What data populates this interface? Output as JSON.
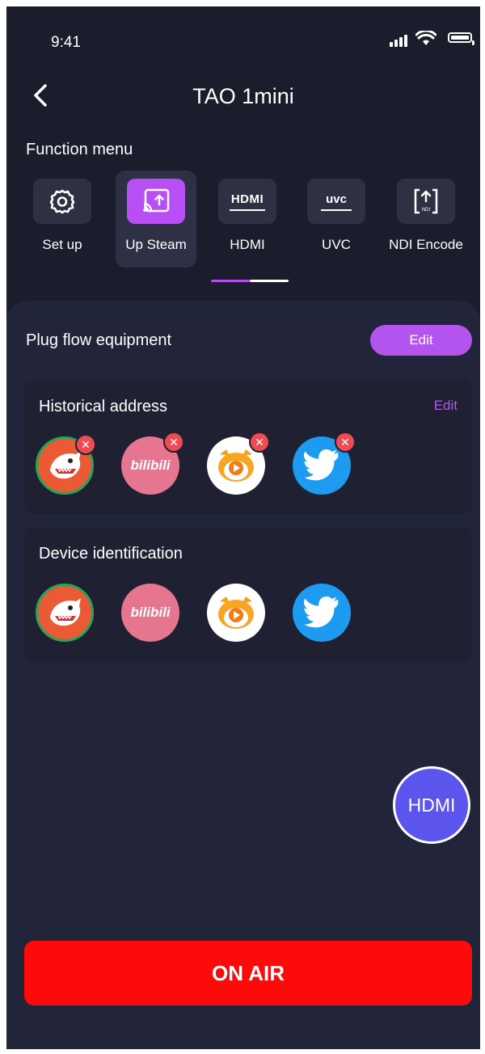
{
  "status_bar": {
    "time": "9:41"
  },
  "nav": {
    "title": "TAO 1mini"
  },
  "function_menu": {
    "label": "Function menu",
    "items": [
      {
        "label": "Set up",
        "icon": "gear-icon"
      },
      {
        "label": "Up Steam",
        "icon": "cast-upload-icon",
        "active": true
      },
      {
        "label": "HDMI",
        "icon": "hdmi-icon",
        "icon_text": "HDMI"
      },
      {
        "label": "UVC",
        "icon": "uvc-icon",
        "icon_text": "UVC"
      },
      {
        "label": "NDI Encode",
        "icon": "ndi-upload-icon",
        "icon_text": "NDI"
      }
    ]
  },
  "panel": {
    "title": "Plug flow equipment",
    "edit_label": "Edit",
    "historical": {
      "title": "Historical address",
      "edit_label": "Edit",
      "logos": [
        "shark-logo-icon",
        "bilibili-logo-icon",
        "tiger-video-logo-icon",
        "twitter-logo-icon"
      ]
    },
    "device": {
      "title": "Device identification",
      "logos": [
        "shark-logo-icon",
        "bilibili-logo-icon",
        "tiger-video-logo-icon",
        "twitter-logo-icon"
      ]
    }
  },
  "fab": {
    "label": "HDMI"
  },
  "on_air": {
    "label": "ON AIR"
  },
  "colors": {
    "background": "#1b1d2d",
    "accent_purple": "#b454ee",
    "on_air_red": "#ff0a0a",
    "fab_blue": "#5b55ee"
  }
}
